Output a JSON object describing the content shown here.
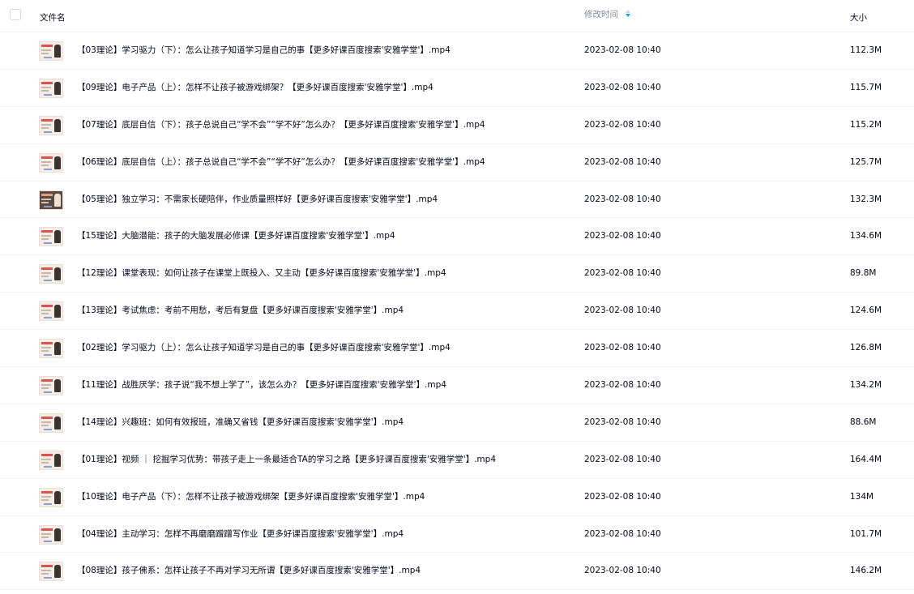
{
  "header": {
    "name_label": "文件名",
    "time_label": "修改时间",
    "size_label": "大小",
    "sort_icon": "sort-desc-icon"
  },
  "files": [
    {
      "name": "【03理论】学习驱力（下）：怎么让孩子知道学习是自己的事【更多好课百度搜索'安雅学堂'】.mp4",
      "time": "2023-02-08 10:40",
      "size": "112.3M",
      "thumb": "video-thumbnail-icon"
    },
    {
      "name": "【09理论】电子产品（上）：怎样不让孩子被游戏绑架？【更多好课百度搜索'安雅学堂'】.mp4",
      "time": "2023-02-08 10:40",
      "size": "115.7M",
      "thumb": "video-thumbnail-icon"
    },
    {
      "name": "【07理论】底层自信（下）：孩子总说自己“学不会”“学不好”怎么办？【更多好课百度搜索'安雅学堂'】.mp4",
      "time": "2023-02-08 10:40",
      "size": "115.2M",
      "thumb": "video-thumbnail-icon"
    },
    {
      "name": "【06理论】底层自信（上）：孩子总说自己“学不会”“学不好”怎么办？【更多好课百度搜索'安雅学堂'】.mp4",
      "time": "2023-02-08 10:40",
      "size": "125.7M",
      "thumb": "video-thumbnail-icon"
    },
    {
      "name": "【05理论】独立学习：不需家长硬陪伴，作业质量照样好【更多好课百度搜索'安雅学堂'】.mp4",
      "time": "2023-02-08 10:40",
      "size": "132.3M",
      "thumb": "video-thumbnail-icon"
    },
    {
      "name": "【15理论】大脑潜能：孩子的大脑发展必修课【更多好课百度搜索'安雅学堂'】.mp4",
      "time": "2023-02-08 10:40",
      "size": "134.6M",
      "thumb": "video-thumbnail-icon"
    },
    {
      "name": "【12理论】课堂表现：如何让孩子在课堂上既投入、又主动【更多好课百度搜索'安雅学堂'】.mp4",
      "time": "2023-02-08 10:40",
      "size": "89.8M",
      "thumb": "video-thumbnail-icon"
    },
    {
      "name": "【13理论】考试焦虑：考前不用愁，考后有复盘【更多好课百度搜索'安雅学堂'】.mp4",
      "time": "2023-02-08 10:40",
      "size": "124.6M",
      "thumb": "video-thumbnail-icon"
    },
    {
      "name": "【02理论】学习驱力（上）：怎么让孩子知道学习是自己的事【更多好课百度搜索'安雅学堂'】.mp4",
      "time": "2023-02-08 10:40",
      "size": "126.8M",
      "thumb": "video-thumbnail-icon"
    },
    {
      "name": "【11理论】战胜厌学：孩子说“我不想上学了”，该怎么办？【更多好课百度搜索'安雅学堂'】.mp4",
      "time": "2023-02-08 10:40",
      "size": "134.2M",
      "thumb": "video-thumbnail-icon"
    },
    {
      "name": "【14理论】兴趣班：如何有效报班，准确又省钱【更多好课百度搜索'安雅学堂'】.mp4",
      "time": "2023-02-08 10:40",
      "size": "88.6M",
      "thumb": "video-thumbnail-icon"
    },
    {
      "name": "【01理论】视频 ｜ 挖掘学习优势：带孩子走上一条最适合TA的学习之路【更多好课百度搜索'安雅学堂'】.mp4",
      "time": "2023-02-08 10:40",
      "size": "164.4M",
      "thumb": "video-thumbnail-icon"
    },
    {
      "name": "【10理论】电子产品（下）：怎样不让孩子被游戏绑架【更多好课百度搜索'安雅学堂'】.mp4",
      "time": "2023-02-08 10:40",
      "size": "134M",
      "thumb": "video-thumbnail-icon"
    },
    {
      "name": "【04理论】主动学习：怎样不再磨磨蹭蹭写作业【更多好课百度搜索'安雅学堂'】.mp4",
      "time": "2023-02-08 10:40",
      "size": "101.7M",
      "thumb": "video-thumbnail-icon"
    },
    {
      "name": "【08理论】孩子佛系：怎样让孩子不再对学习无所谓【更多好课百度搜索'安雅学堂'】.mp4",
      "time": "2023-02-08 10:40",
      "size": "146.2M",
      "thumb": "video-thumbnail-icon"
    }
  ]
}
